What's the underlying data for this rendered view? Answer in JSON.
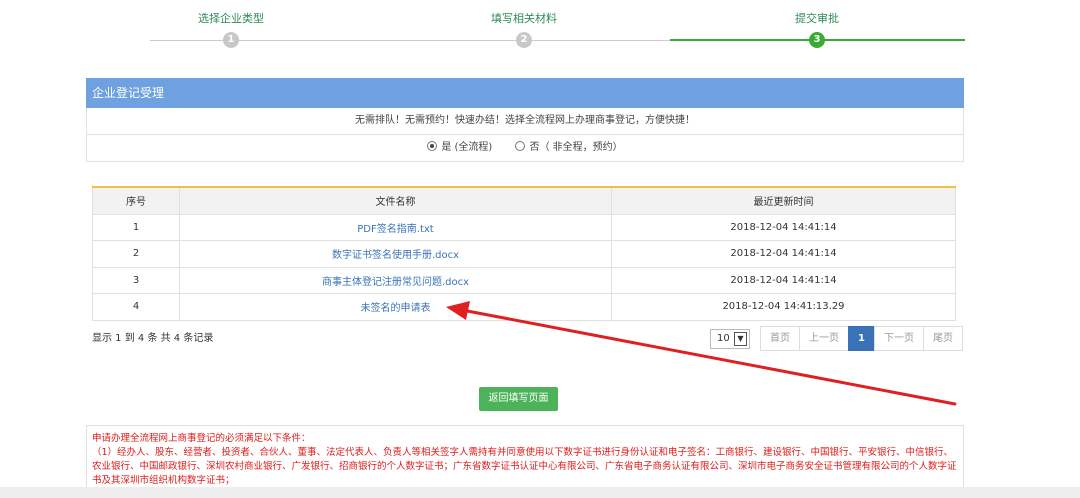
{
  "steps": [
    {
      "label": "选择企业类型",
      "num": "1"
    },
    {
      "label": "填写相关材料",
      "num": "2"
    },
    {
      "label": "提交审批",
      "num": "3"
    }
  ],
  "panel": {
    "title": "企业登记受理",
    "slogan": "无需排队！无需预约！快速办结！选择全流程网上办理商事登记，方便快捷！",
    "option_yes": "是 (全流程)",
    "option_no": "否（ 非全程，预约）"
  },
  "table": {
    "headers": [
      "序号",
      "文件名称",
      "最近更新时间"
    ],
    "rows": [
      {
        "no": "1",
        "name": "PDF签名指南.txt",
        "time": "2018-12-04 14:41:14"
      },
      {
        "no": "2",
        "name": "数字证书签名使用手册.docx",
        "time": "2018-12-04 14:41:14"
      },
      {
        "no": "3",
        "name": "商事主体登记注册常见问题.docx",
        "time": "2018-12-04 14:41:14"
      },
      {
        "no": "4",
        "name": "未签名的申请表",
        "time": "2018-12-04 14:41:13.29"
      }
    ]
  },
  "records": "显示 1 到 4 条 共 4 条记录",
  "pager": {
    "page_size": "10",
    "first": "首页",
    "prev": "上一页",
    "current": "1",
    "next": "下一页",
    "last": "尾页"
  },
  "return_button": "返回填写页面",
  "notice": {
    "line1": "申请办理全流程网上商事登记的必须满足以下条件：",
    "line2": "（1）经办人、股东、经营者、投资者、合伙人、董事、法定代表人、负责人等相关签字人需持有并同意使用以下数字证书进行身份认证和电子签名：工商银行、建设银行、中国银行、平安银行、中信银行、农业银行、中国邮政银行、深圳农村商业银行、广发银行、招商银行的个人数字证书；广东省数字证书认证中心有限公司、广东省电子商务认证有限公司、深圳市电子商务安全证书管理有限公司的个人数字证书及其深圳市组织机构数字证书；"
  },
  "colors": {
    "step_active": "#3aaa35",
    "panel_head": "#6fa0df",
    "link": "#3a72b8",
    "notice_text": "#e01b1b",
    "annotation_arrow": "#e02020",
    "return_button": "#4cb35a"
  }
}
